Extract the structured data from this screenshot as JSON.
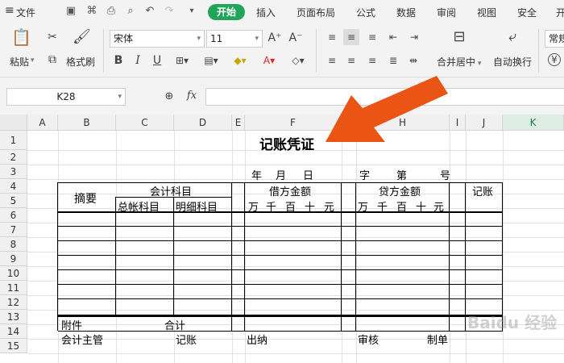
{
  "menu": {
    "file_label": "文件",
    "tabs": [
      "开始",
      "插入",
      "页面布局",
      "公式",
      "数据",
      "审阅",
      "视图",
      "安全",
      "开"
    ]
  },
  "ribbon": {
    "paste_label": "粘贴",
    "format_painter_label": "格式刷",
    "font_name": "宋体",
    "font_size": "11",
    "merge_center_label": "合并居中",
    "wrap_text_label": "自动换行",
    "number_format": "常规"
  },
  "formula_bar": {
    "name_box": "K28",
    "fx_label": "fx",
    "formula_value": ""
  },
  "sheet": {
    "columns": [
      "A",
      "B",
      "C",
      "D",
      "E",
      "F",
      "G",
      "H",
      "I",
      "J",
      "K"
    ],
    "selected_column": "K",
    "rows": [
      "1",
      "2",
      "3",
      "4",
      "5",
      "6",
      "7",
      "8",
      "9",
      "10",
      "11",
      "12",
      "13",
      "14",
      "15"
    ],
    "title": "记账凭证",
    "date_year": "年",
    "date_month": "月",
    "date_day": "日",
    "word_label": "字",
    "section_label": "第",
    "number_label": "号",
    "summary_header": "摘要",
    "account_header": "会计科目",
    "general_account": "总帐科目",
    "detail_account": "明细科目",
    "debit_header": "借方金额",
    "credit_header": "贷方金额",
    "posting_header": "记账",
    "unit_wan": "万",
    "unit_qian": "千",
    "unit_bai": "百",
    "unit_shi": "十",
    "unit_yuan": "元",
    "attachment_label": "附件",
    "total_label": "合计",
    "chief_accountant_label": "会计主管",
    "bookkeeping_label": "记账",
    "cashier_label": "出纳",
    "review_label": "审核",
    "prepared_label": "制单"
  },
  "watermark": "Baidu 经验",
  "colors": {
    "accent": "#22a55b",
    "arrow": "#ea5414"
  }
}
